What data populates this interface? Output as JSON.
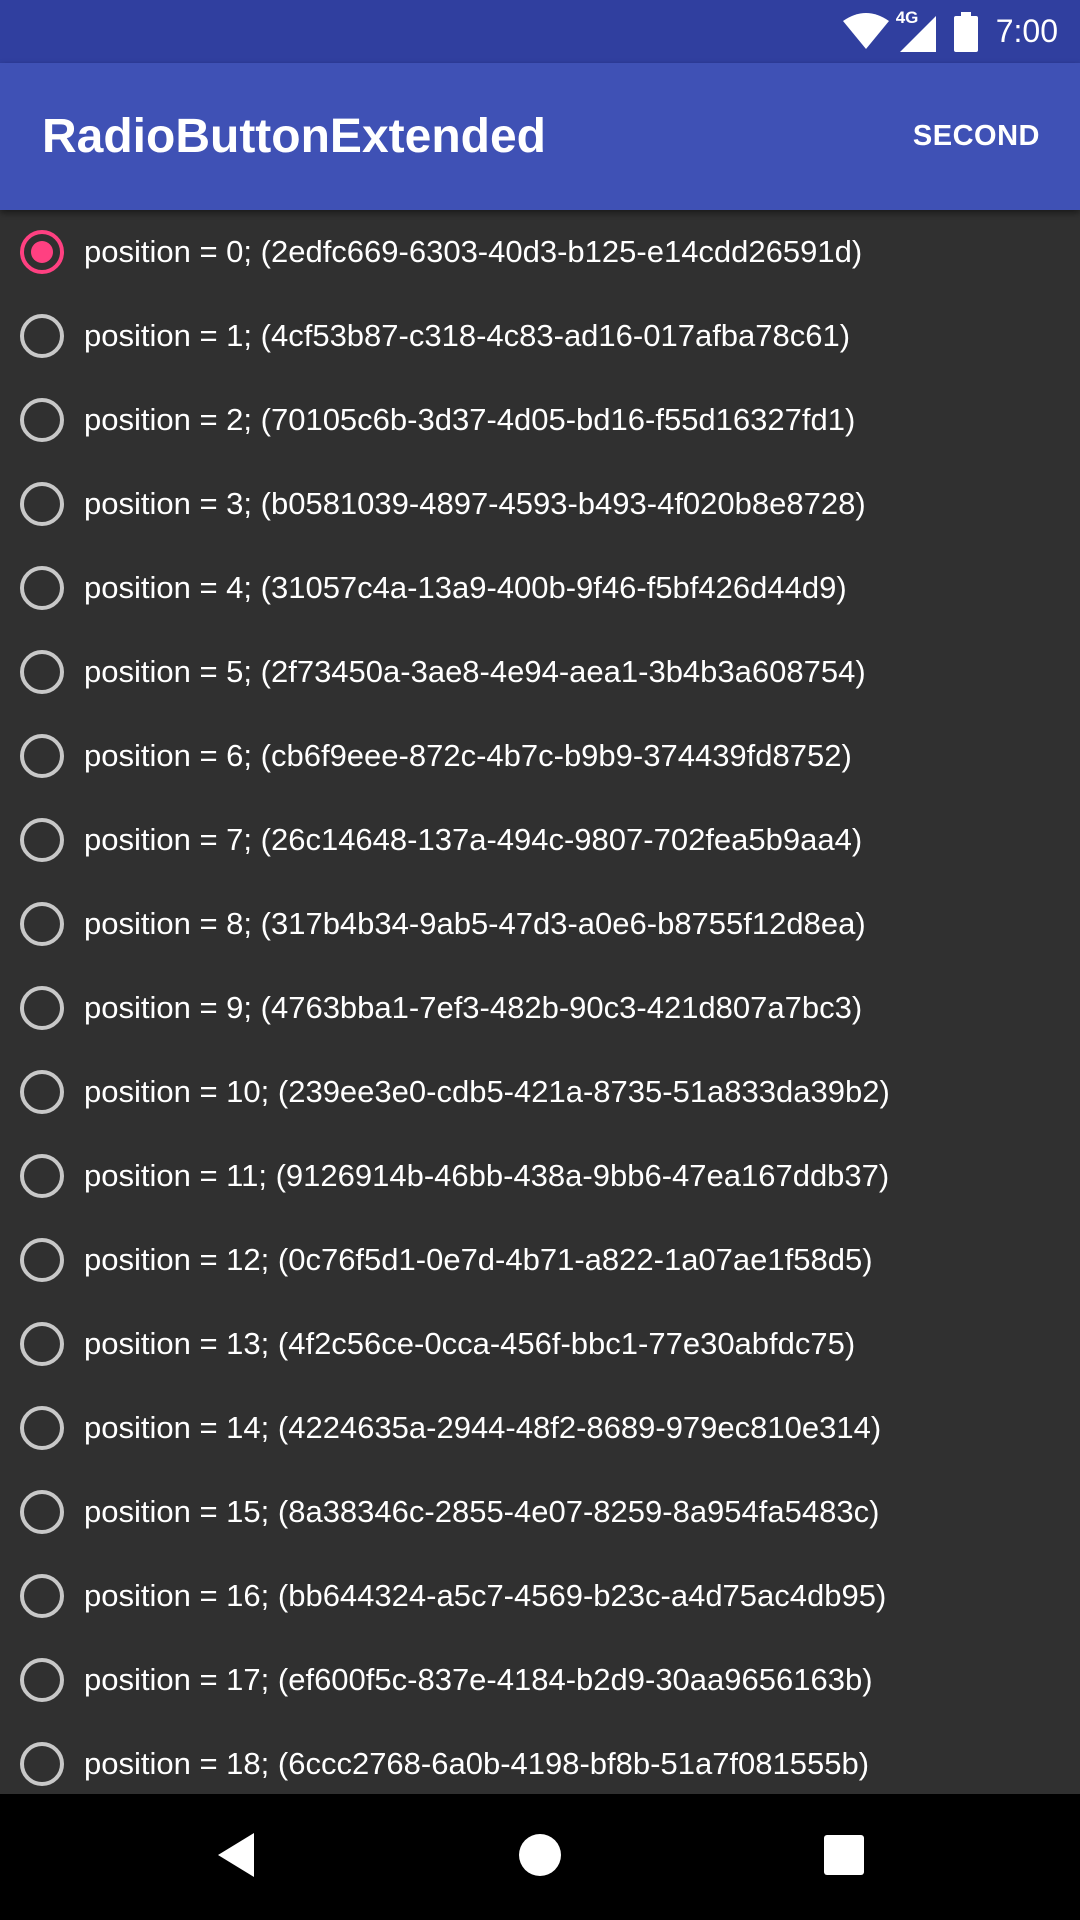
{
  "status_bar": {
    "network_label": "4G",
    "time": "7:00",
    "icons": [
      "wifi-icon",
      "cellular-signal-icon",
      "battery-icon"
    ]
  },
  "app_bar": {
    "title": "RadioButtonExtended",
    "action_label": "SECOND"
  },
  "list": {
    "selected_index": 0,
    "items": [
      {
        "label": "position = 0; (2edfc669-6303-40d3-b125-e14cdd26591d)",
        "checked": true
      },
      {
        "label": "position = 1; (4cf53b87-c318-4c83-ad16-017afba78c61)",
        "checked": false
      },
      {
        "label": "position = 2; (70105c6b-3d37-4d05-bd16-f55d16327fd1)",
        "checked": false
      },
      {
        "label": "position = 3; (b0581039-4897-4593-b493-4f020b8e8728)",
        "checked": false
      },
      {
        "label": "position = 4; (31057c4a-13a9-400b-9f46-f5bf426d44d9)",
        "checked": false
      },
      {
        "label": "position = 5; (2f73450a-3ae8-4e94-aea1-3b4b3a608754)",
        "checked": false
      },
      {
        "label": "position = 6; (cb6f9eee-872c-4b7c-b9b9-374439fd8752)",
        "checked": false
      },
      {
        "label": "position = 7; (26c14648-137a-494c-9807-702fea5b9aa4)",
        "checked": false
      },
      {
        "label": "position = 8; (317b4b34-9ab5-47d3-a0e6-b8755f12d8ea)",
        "checked": false
      },
      {
        "label": "position = 9; (4763bba1-7ef3-482b-90c3-421d807a7bc3)",
        "checked": false
      },
      {
        "label": "position = 10; (239ee3e0-cdb5-421a-8735-51a833da39b2)",
        "checked": false
      },
      {
        "label": "position = 11; (9126914b-46bb-438a-9bb6-47ea167ddb37)",
        "checked": false
      },
      {
        "label": "position = 12; (0c76f5d1-0e7d-4b71-a822-1a07ae1f58d5)",
        "checked": false
      },
      {
        "label": "position = 13; (4f2c56ce-0cca-456f-bbc1-77e30abfdc75)",
        "checked": false
      },
      {
        "label": "position = 14; (4224635a-2944-48f2-8689-979ec810e314)",
        "checked": false
      },
      {
        "label": "position = 15; (8a38346c-2855-4e07-8259-8a954fa5483c)",
        "checked": false
      },
      {
        "label": "position = 16; (bb644324-a5c7-4569-b23c-a4d75ac4db95)",
        "checked": false
      },
      {
        "label": "position = 17; (ef600f5c-837e-4184-b2d9-30aa9656163b)",
        "checked": false
      },
      {
        "label": "position = 18; (6ccc2768-6a0b-4198-bf8b-51a7f081555b)",
        "checked": false
      }
    ]
  },
  "nav_bar": {
    "buttons": [
      "back-icon",
      "home-icon",
      "recents-icon"
    ]
  },
  "colors": {
    "status_bar": "#303F9F",
    "app_bar": "#3F51B5",
    "accent": "#FF4081",
    "background": "#303030",
    "radio_unchecked": "#C8C8C8",
    "nav_bar": "#000000"
  }
}
